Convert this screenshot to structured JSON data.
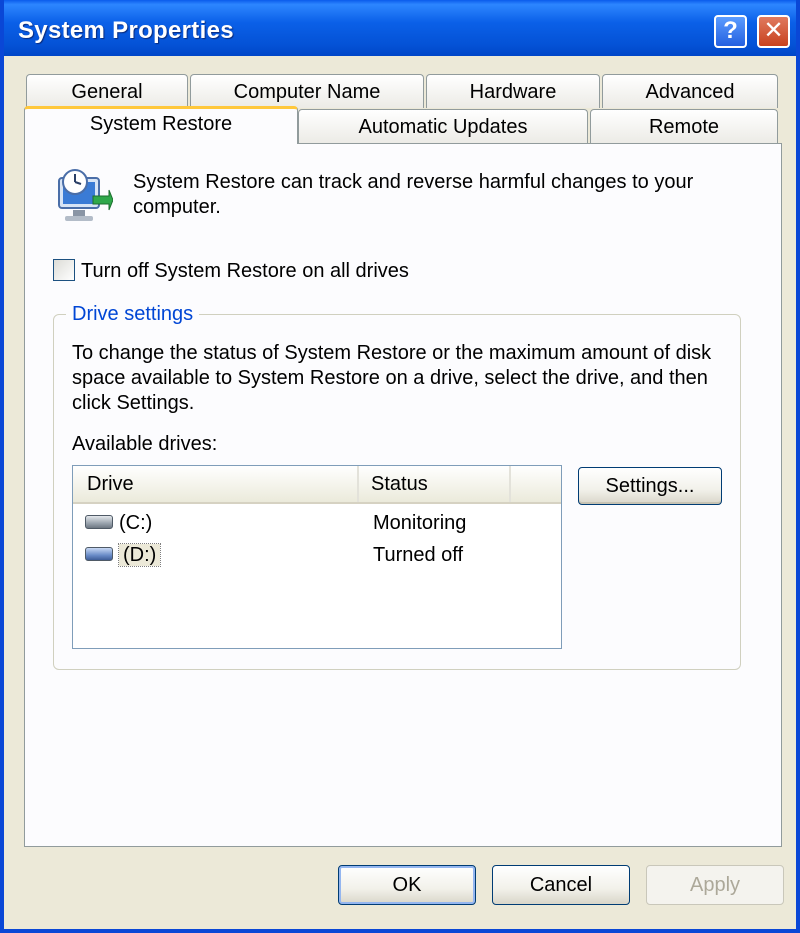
{
  "window": {
    "title": "System Properties",
    "help_symbol": "?",
    "close_symbol": "✕"
  },
  "tabs": {
    "row_back": [
      {
        "label": "General"
      },
      {
        "label": "Computer Name"
      },
      {
        "label": "Hardware"
      },
      {
        "label": "Advanced"
      }
    ],
    "row_front": [
      {
        "label": "System Restore",
        "active": true
      },
      {
        "label": "Automatic Updates"
      },
      {
        "label": "Remote"
      }
    ]
  },
  "system_restore": {
    "intro_text": "System Restore can track and reverse harmful changes to your computer.",
    "turn_off_checkbox": {
      "label": "Turn off System Restore on all drives",
      "checked": false
    },
    "drive_settings": {
      "group_label": "Drive settings",
      "description": "To change the status of System Restore or the maximum amount of disk space available to System Restore on a drive, select the drive, and then click Settings.",
      "available_label": "Available drives:",
      "columns": {
        "drive": "Drive",
        "status": "Status"
      },
      "rows": [
        {
          "drive": "(C:)",
          "status": "Monitoring"
        },
        {
          "drive": "(D:)",
          "status": "Turned off"
        }
      ],
      "settings_button": "Settings..."
    }
  },
  "buttons": {
    "ok": "OK",
    "cancel": "Cancel",
    "apply": "Apply"
  },
  "colors": {
    "titlebar": "#0452d6",
    "active_tab_accent": "#ffc83c",
    "group_label": "#0046d5"
  },
  "icons": {
    "intro": "system-restore-icon",
    "drive": "hard-drive-icon"
  }
}
